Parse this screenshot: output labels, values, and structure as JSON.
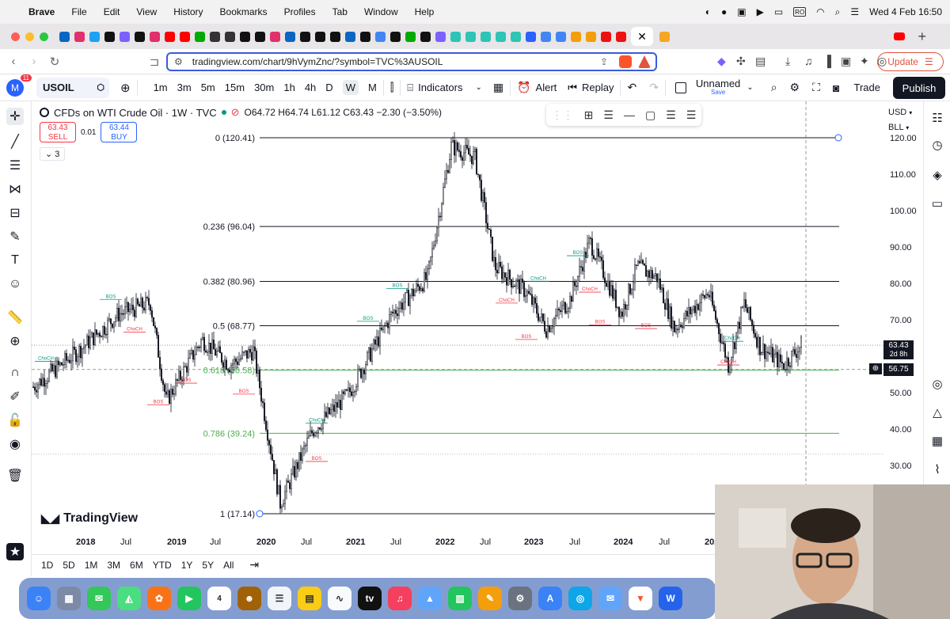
{
  "menubar": {
    "app": "Brave",
    "items": [
      "File",
      "Edit",
      "View",
      "History",
      "Bookmarks",
      "Profiles",
      "Tab",
      "Window",
      "Help"
    ],
    "input_source": "RO",
    "datetime": "Wed 4 Feb  16:50"
  },
  "browser": {
    "url": "tradingview.com/chart/9hVymZnc/?symbol=TVC%3AUSOIL",
    "update_label": "Update",
    "brave_count": "1"
  },
  "tv": {
    "avatar_letter": "M",
    "notif_count": "11",
    "symbol": "USOIL",
    "timeframes": [
      "1m",
      "3m",
      "5m",
      "15m",
      "30m",
      "1h",
      "4h",
      "D",
      "W",
      "M"
    ],
    "active_timeframe": "W",
    "indicators_label": "Indicators",
    "alert_label": "Alert",
    "replay_label": "Replay",
    "layout_name": "Unnamed",
    "layout_save": "Save",
    "trade_label": "Trade",
    "publish_label": "Publish"
  },
  "legend": {
    "title": "CFDs on WTI Crude Oil · 1W · TVC",
    "ohlc": "O64.72  H64.74  L61.12  C63.43  −2.30 (−3.50%)",
    "sell_price": "63.43",
    "sell_label": "SELL",
    "spread": "0.01",
    "buy_price": "63.44",
    "buy_label": "BUY",
    "collapse_count": "3"
  },
  "price_axis": {
    "currency": "USD",
    "unit": "BLL",
    "labels": [
      "120.00",
      "110.00",
      "100.00",
      "90.00",
      "80.00",
      "70.00",
      "60.00",
      "50.00",
      "40.00",
      "30.00"
    ],
    "current_price": "63.43",
    "countdown": "2d 8h",
    "crosshair_price": "56.75"
  },
  "time_axis": {
    "labels": [
      "2018",
      "Jul",
      "2019",
      "Jul",
      "2020",
      "Jul",
      "2021",
      "Jul",
      "2022",
      "Jul",
      "2023",
      "Jul",
      "2024",
      "Jul",
      "2025"
    ]
  },
  "bottom": {
    "ranges": [
      "1D",
      "5D",
      "1M",
      "3M",
      "6M",
      "YTD",
      "1Y",
      "5Y",
      "All"
    ]
  },
  "brand": "TradingView",
  "chart_data": {
    "type": "candlestick",
    "symbol": "USOIL",
    "interval": "1W",
    "ylim": [
      17.14,
      125
    ],
    "fib_levels": [
      {
        "label": "0 (120.41)",
        "value": 120.41,
        "color": "#131722"
      },
      {
        "label": "0.236 (96.04)",
        "value": 96.04,
        "color": "#131722"
      },
      {
        "label": "0.382 (80.96)",
        "value": 80.96,
        "color": "#131722"
      },
      {
        "label": "0.5 (68.77)",
        "value": 68.77,
        "color": "#131722"
      },
      {
        "label": "0.618 (56.58)",
        "value": 56.58,
        "color": "#4caf50"
      },
      {
        "label": "0.786 (39.24)",
        "value": 39.24,
        "color": "#4caf50"
      },
      {
        "label": "1 (17.14)",
        "value": 17.14,
        "color": "#131722"
      }
    ],
    "series": [
      {
        "name": "USOIL",
        "x": [
          "2017-11",
          "2018-01",
          "2018-07",
          "2018-10",
          "2019-01",
          "2019-04",
          "2019-07",
          "2020-01",
          "2020-04",
          "2020-07",
          "2021-01",
          "2021-07",
          "2021-10",
          "2022-03",
          "2022-06",
          "2022-09",
          "2023-01",
          "2023-03",
          "2023-07",
          "2023-09",
          "2024-01",
          "2024-04",
          "2024-07",
          "2024-09",
          "2025-01",
          "2025-04",
          "2025-06",
          "2025-09",
          "2026-01",
          "2026-02"
        ],
        "values": [
          52,
          62,
          72,
          75,
          48,
          65,
          58,
          62,
          20,
          40,
          50,
          72,
          82,
          118,
          115,
          85,
          78,
          68,
          76,
          92,
          72,
          85,
          82,
          68,
          78,
          58,
          75,
          63,
          58,
          63.43
        ]
      }
    ],
    "annotations": [
      "BOS",
      "ChoCH"
    ]
  }
}
